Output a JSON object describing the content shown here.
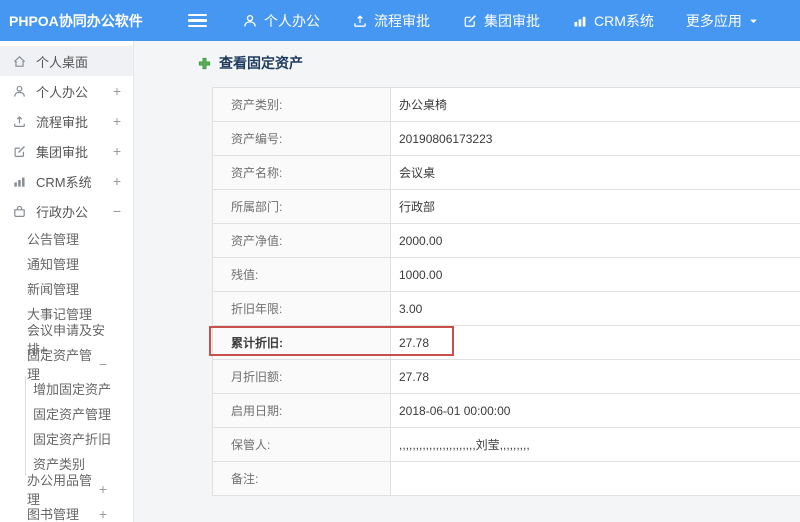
{
  "colors": {
    "header_bg": "#4697f1",
    "sidebar_selected_bg": "#eff1f4",
    "title_color": "#1e3a5f",
    "highlight_border": "#c94f4c",
    "plus_green": "#54b054"
  },
  "header": {
    "logo": "PHPOA协同办公软件",
    "menu_icon": "hamburger-icon",
    "nav": [
      {
        "label": "个人办公",
        "icon": "person-icon"
      },
      {
        "label": "流程审批",
        "icon": "process-icon"
      },
      {
        "label": "集团审批",
        "icon": "edit-icon"
      },
      {
        "label": "CRM系统",
        "icon": "chart-icon"
      },
      {
        "label": "更多应用",
        "dropdown": true
      }
    ]
  },
  "sidebar": {
    "items": [
      {
        "label": "个人桌面",
        "icon": "home-icon",
        "level": 0,
        "selected": true
      },
      {
        "label": "个人办公",
        "icon": "person-icon",
        "level": 0,
        "toggle": "+"
      },
      {
        "label": "流程审批",
        "icon": "process-icon",
        "level": 0,
        "toggle": "+"
      },
      {
        "label": "集团审批",
        "icon": "edit-icon",
        "level": 0,
        "toggle": "+"
      },
      {
        "label": "CRM系统",
        "icon": "chart-icon",
        "level": 0,
        "toggle": "+"
      },
      {
        "label": "行政办公",
        "icon": "briefcase-icon",
        "level": 0,
        "toggle": "−"
      },
      {
        "label": "公告管理",
        "level": 1
      },
      {
        "label": "通知管理",
        "level": 1
      },
      {
        "label": "新闻管理",
        "level": 1
      },
      {
        "label": "大事记管理",
        "level": 1
      },
      {
        "label": "会议申请及安排+",
        "level": 1
      },
      {
        "label": "固定资产管理",
        "level": 1,
        "toggle": "−"
      },
      {
        "label": "增加固定资产",
        "level": 2
      },
      {
        "label": "固定资产管理",
        "level": 2
      },
      {
        "label": "固定资产折旧",
        "level": 2
      },
      {
        "label": "资产类别",
        "level": 2
      },
      {
        "label": "办公用品管理",
        "level": 1,
        "toggle": "+"
      },
      {
        "label": "图书管理",
        "level": 1,
        "toggle": "+"
      }
    ]
  },
  "main": {
    "title": "查看固定资产",
    "title_icon": "plus-icon"
  },
  "table": {
    "rows": [
      {
        "label": "资产类别:",
        "value": "办公桌椅"
      },
      {
        "label": "资产编号:",
        "value": "20190806173223"
      },
      {
        "label": "资产名称:",
        "value": "会议桌"
      },
      {
        "label": "所属部门:",
        "value": "行政部"
      },
      {
        "label": "资产净值:",
        "value": "2000.00"
      },
      {
        "label": "残值:",
        "value": "1000.00"
      },
      {
        "label": "折旧年限:",
        "value": "3.00"
      },
      {
        "label": "累计折旧:",
        "value": "27.78",
        "highlighted": true
      },
      {
        "label": "月折旧额:",
        "value": "27.78"
      },
      {
        "label": "启用日期:",
        "value": "2018-06-01 00:00:00"
      },
      {
        "label": "保管人:",
        "value": ",,,,,,,,,,,,,,,,,,,,,,,刘莹,,,,,,,,,"
      },
      {
        "label": "备注:",
        "value": ""
      }
    ]
  }
}
